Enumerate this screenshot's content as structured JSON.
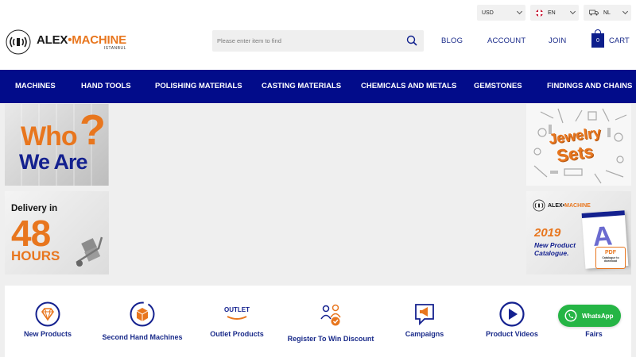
{
  "header": {
    "logo": {
      "main_left": "ALEX",
      "dot": "•",
      "main_right": "MACHINE",
      "sub": "ISTANBUL",
      "mark_text": "ALEX"
    },
    "currency": "USD",
    "language": "EN",
    "shipping_country": "NL",
    "search": {
      "placeholder": "Please enter item to find"
    },
    "links": {
      "blog": "BLOG",
      "account": "ACCOUNT",
      "join": "JOIN"
    },
    "cart": {
      "count": "0",
      "label": "CART"
    }
  },
  "nav": {
    "items": [
      "MACHINES",
      "HAND TOOLS",
      "POLISHING MATERIALS",
      "CASTING MATERIALS",
      "CHEMICALS AND METALS",
      "GEMSTONES",
      "FINDINGS AND CHAINS"
    ]
  },
  "banners": {
    "who": {
      "line1": "Who",
      "mark": "?",
      "line2": "We Are"
    },
    "delivery": {
      "line1": "Delivery in",
      "line2": "48",
      "line3": "HOURS"
    },
    "jewelry": {
      "line1": "Jewelry",
      "line2": "Sets"
    },
    "catalogue": {
      "logo": "ALEX•MACHINE",
      "logo_left": "ALEX•",
      "logo_right": "MACHINE",
      "year": "2019",
      "line1": "New Product",
      "line2": "Catalogue.",
      "book_letter": "A",
      "pdf": "PDF",
      "pdf_small": "Catalogue to download"
    }
  },
  "features": [
    {
      "label": "New Products",
      "icon": "diamond-icon"
    },
    {
      "label": "Second Hand Machines",
      "icon": "recycle-box-icon"
    },
    {
      "label": "Outlet Products",
      "icon": "outlet-tag-icon"
    },
    {
      "label": "Register To Win Discount",
      "icon": "register-people-icon"
    },
    {
      "label": "Campaigns",
      "icon": "megaphone-icon"
    },
    {
      "label": "Product Videos",
      "icon": "play-icon"
    },
    {
      "label": "Fairs",
      "icon": "fairs-icon"
    }
  ],
  "whatsapp": {
    "label": "WhatsApp"
  },
  "colors": {
    "navy": "#020c8a",
    "orange": "#e8761e",
    "whatsapp_green": "#25b545",
    "link_blue": "#1a2b8a"
  }
}
